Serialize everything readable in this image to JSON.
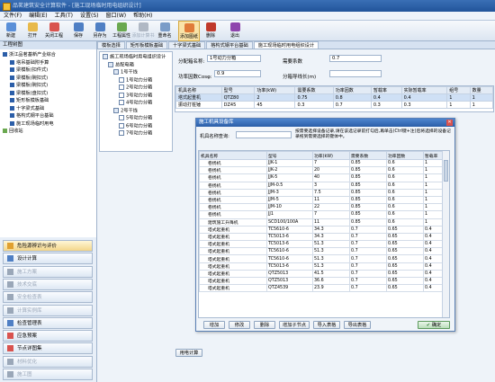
{
  "window": {
    "title": "品茗建筑安全计算软件 - [施工现场临时用电组织设计]"
  },
  "menu": [
    "文件(F)",
    "编辑(E)",
    "工具(T)",
    "设置(S)",
    "窗口(W)",
    "帮助(H)"
  ],
  "toolbar": [
    {
      "label": "新建",
      "icon": "new-icon",
      "color": "#5a8fd8"
    },
    {
      "label": "打开",
      "icon": "open-icon",
      "color": "#e8b94a"
    },
    {
      "label": "关闭工程",
      "icon": "close-project-icon",
      "color": "#d9534f"
    },
    {
      "label": "保存",
      "icon": "save-icon",
      "color": "#4f7fc4"
    },
    {
      "label": "另存为",
      "icon": "save-as-icon",
      "color": "#4f7fc4"
    },
    {
      "label": "工程属性",
      "icon": "properties-icon",
      "color": "#6aa84f"
    },
    {
      "label": "添加计算书",
      "icon": "add-calc-icon",
      "color": "#b0b8c4",
      "disabled": true
    },
    {
      "label": "重命名",
      "icon": "rename-icon",
      "color": "#7a9cc8"
    },
    {
      "label": "添加图纸",
      "icon": "add-drawing-icon",
      "color": "#e07b39",
      "active": true
    },
    {
      "label": "删除",
      "icon": "delete-icon",
      "color": "#c0392b"
    },
    {
      "label": "退出",
      "icon": "exit-icon",
      "color": "#8e44ad"
    }
  ],
  "left": {
    "title": "工程树图",
    "tree": [
      {
        "label": "浙江品茗基新产业综合",
        "level": 0,
        "color": "#2b5ea8"
      },
      {
        "label": "塔吊基础附手算",
        "level": 1,
        "color": "#2b5ea8"
      },
      {
        "label": "梁模板(扣件式)",
        "level": 1,
        "color": "#2b5ea8"
      },
      {
        "label": "梁模板(碗扣式)",
        "level": 1,
        "color": "#2b5ea8"
      },
      {
        "label": "梁模板(碗扣式)",
        "level": 1,
        "color": "#2b5ea8"
      },
      {
        "label": "梁模板(盘扣式)",
        "level": 1,
        "color": "#2b5ea8"
      },
      {
        "label": "矩形板模板基础",
        "level": 1,
        "color": "#2b5ea8"
      },
      {
        "label": "十字梁式基础",
        "level": 1,
        "color": "#2b5ea8"
      },
      {
        "label": "格构式钢平台基础",
        "level": 1,
        "color": "#2b5ea8"
      },
      {
        "label": "施工现场临时用电",
        "level": 1,
        "color": "#2b5ea8"
      },
      {
        "label": "回收站",
        "level": 0,
        "color": "#6aa84f"
      }
    ],
    "nav": [
      {
        "label": "危险源辨识与评价",
        "disabled": false,
        "selected": true,
        "icon": "warning-icon",
        "color": "#e0a030"
      },
      {
        "label": "设计计算",
        "disabled": false,
        "icon": "calc-icon",
        "color": "#4f7fc4"
      },
      {
        "label": "施工方案",
        "disabled": true,
        "icon": "plan-icon",
        "color": "#9aa7b8"
      },
      {
        "label": "技术交底",
        "disabled": true,
        "icon": "disclosure-icon",
        "color": "#9aa7b8"
      },
      {
        "label": "安全检查表",
        "disabled": true,
        "icon": "checklist-icon",
        "color": "#9aa7b8"
      },
      {
        "label": "计算实例库",
        "disabled": true,
        "icon": "library-icon",
        "color": "#9aa7b8"
      },
      {
        "label": "检查管理表",
        "disabled": false,
        "icon": "table-icon",
        "color": "#4f7fc4"
      },
      {
        "label": "应急预案",
        "disabled": false,
        "icon": "emergency-icon",
        "color": "#d9534f"
      },
      {
        "label": "节点详图集",
        "disabled": false,
        "icon": "detail-icon",
        "color": "#d9534f"
      },
      {
        "label": "材料优化",
        "disabled": true,
        "icon": "material-icon",
        "color": "#9aa7b8"
      },
      {
        "label": "施工图",
        "disabled": true,
        "icon": "drawing-icon",
        "color": "#9aa7b8"
      }
    ]
  },
  "tabs": [
    "模板选择",
    "矩形板模板基础",
    "十字梁式基础",
    "格构式钢平台基础",
    "施工现场临时用电组织设计"
  ],
  "subtree": [
    {
      "label": "施工现场临时用电组织设计",
      "level": 0
    },
    {
      "label": "总配电箱",
      "level": 1
    },
    {
      "label": "1号干线",
      "level": 2
    },
    {
      "label": "1号动力分箱",
      "level": 3
    },
    {
      "label": "2号动力分箱",
      "level": 3
    },
    {
      "label": "3号动力分箱",
      "level": 3
    },
    {
      "label": "4号动力分箱",
      "level": 3
    },
    {
      "label": "2号干线",
      "level": 2
    },
    {
      "label": "5号动力分箱",
      "level": 3
    },
    {
      "label": "6号动力分箱",
      "level": 3
    },
    {
      "label": "7号动力分箱",
      "level": 3
    }
  ],
  "form": {
    "branch_label": "分配箱名称:",
    "branch_value": "1号动力分箱",
    "demand_label": "需要系数",
    "demand_value": "0.7",
    "pf_label": "功率因数Cosφ:",
    "pf_value": "0.9",
    "cable_label": "分箱导线长(m)",
    "cable_value": ""
  },
  "main_table": {
    "headers": [
      "机具名称",
      "型号",
      "功率(kW)",
      "需要系数",
      "功率因数",
      "暂载率",
      "实际暂载率",
      "组号",
      "数量"
    ],
    "rows": [
      [
        "塔式起重机",
        "QTZ80",
        "2",
        "0.75",
        "0.8",
        "0.4",
        "0.4",
        "1",
        "1"
      ],
      [
        "振动打桩锤",
        "DZ45",
        "45",
        "0.3",
        "0.7",
        "0.3",
        "0.3",
        "1",
        "1"
      ]
    ]
  },
  "dialog": {
    "title": "施工机具设备库",
    "search_label": "机具名称查询:",
    "search_value": "",
    "hint": "按需要选择设备记录,请在该选记录前打勾后,再单击(Ctrl键+注)后将选择的设备记录拖到需要选择的键体中。",
    "headers": [
      "机具名称",
      "型号",
      "功率(kW)",
      "需要系数",
      "功率因数",
      "暂载率"
    ],
    "rows": [
      [
        "卷扬机",
        "JJK-1",
        "7",
        "0.85",
        "0.6",
        "1"
      ],
      [
        "卷扬机",
        "JJK-2",
        "20",
        "0.85",
        "0.6",
        "1"
      ],
      [
        "卷扬机",
        "JJK-5",
        "40",
        "0.85",
        "0.6",
        "1"
      ],
      [
        "卷扬机",
        "JJM-0.5",
        "3",
        "0.85",
        "0.6",
        "1"
      ],
      [
        "卷扬机",
        "JJM-3",
        "7.5",
        "0.85",
        "0.6",
        "1"
      ],
      [
        "卷扬机",
        "JJM-5",
        "11",
        "0.85",
        "0.6",
        "1"
      ],
      [
        "卷扬机",
        "JJM-10",
        "22",
        "0.85",
        "0.6",
        "1"
      ],
      [
        "卷扬机",
        "JJ1",
        "7",
        "0.85",
        "0.6",
        "1"
      ],
      [
        "建筑施工升降机",
        "SCD100/100A",
        "11",
        "0.85",
        "0.6",
        "1"
      ],
      [
        "塔式起重机",
        "TC5610-6",
        "34.3",
        "0.7",
        "0.65",
        "0.4"
      ],
      [
        "塔式起重机",
        "TC5013-6",
        "34.3",
        "0.7",
        "0.65",
        "0.4"
      ],
      [
        "塔式起重机",
        "TC5013-6",
        "51.3",
        "0.7",
        "0.65",
        "0.4"
      ],
      [
        "塔式起重机",
        "TC5610-6",
        "51.3",
        "0.7",
        "0.65",
        "0.4"
      ],
      [
        "塔式起重机",
        "TC5610-6",
        "51.3",
        "0.7",
        "0.65",
        "0.4"
      ],
      [
        "塔式起重机",
        "TC5013-6",
        "51.3",
        "0.7",
        "0.65",
        "0.4"
      ],
      [
        "塔式起重机",
        "QTZ5013",
        "41.5",
        "0.7",
        "0.65",
        "0.4"
      ],
      [
        "塔式起重机",
        "QTZ5013",
        "36.6",
        "0.7",
        "0.65",
        "0.4"
      ],
      [
        "塔式起重机",
        "QTZ4539",
        "23.9",
        "0.7",
        "0.65",
        "0.4"
      ]
    ],
    "buttons": [
      "增加",
      "修改",
      "删除",
      "增加子节点",
      "导入表格",
      "导出表格"
    ],
    "ok": "确定"
  },
  "calc_button": "用电计算"
}
